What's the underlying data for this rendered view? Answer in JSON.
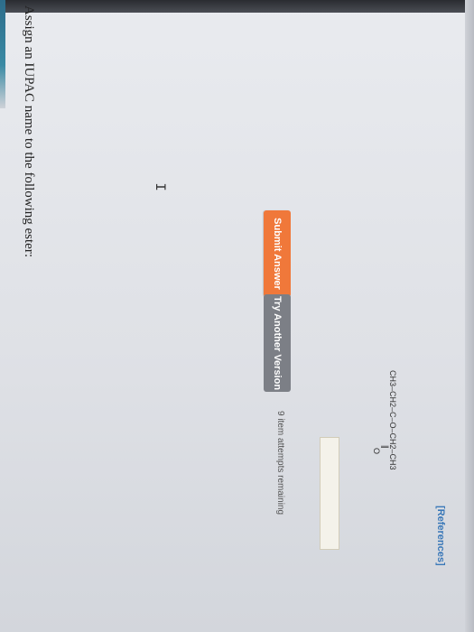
{
  "question": {
    "text": "Assign an IUPAC name to the following ester:"
  },
  "references_link": "[References]",
  "structure": {
    "carbonyl_oxygen": "O",
    "double_bond": "||",
    "formula_text": "CH3–CH2–C–O–CH2–CH3"
  },
  "answer_input": {
    "value": ""
  },
  "buttons": {
    "submit": "Submit Answer",
    "try_another": "Try Another Version"
  },
  "attempts_text": "9 item attempts remaining",
  "colors": {
    "submit_bg": "#f0783a",
    "try_bg": "#7c7f86",
    "link": "#3a78b8"
  },
  "icons": {
    "cursor": "text-cursor-icon"
  }
}
